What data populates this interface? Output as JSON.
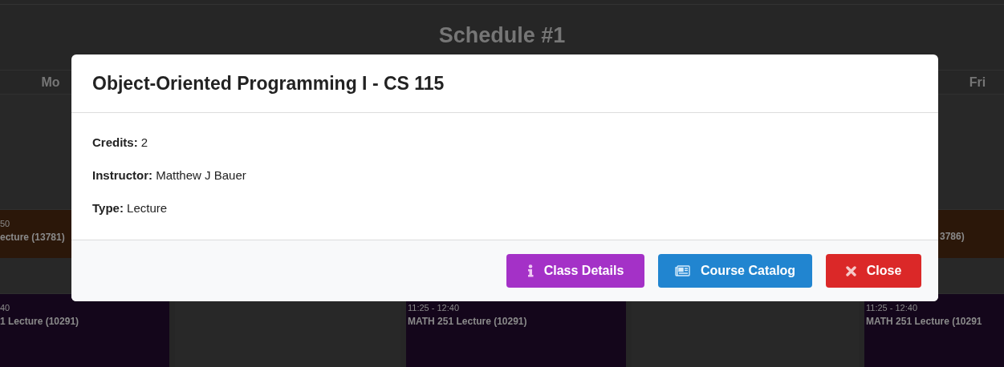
{
  "schedule": {
    "title": "Schedule #1",
    "days": [
      {
        "label": "Mo",
        "slots": [
          {
            "kind": "empty"
          },
          {
            "kind": "event",
            "color": "#2b1709",
            "time": "50",
            "label": "ecture (13781)"
          },
          {
            "kind": "empty"
          },
          {
            "kind": "event",
            "color": "#14061b",
            "time": "40",
            "label": "1 Lecture (10291)"
          }
        ]
      },
      {
        "slots": [
          {
            "kind": "empty"
          },
          {
            "kind": "empty"
          },
          {
            "kind": "empty"
          },
          {
            "kind": "empty"
          }
        ]
      },
      {
        "slots": [
          {
            "kind": "empty"
          },
          {
            "kind": "empty"
          },
          {
            "kind": "empty"
          },
          {
            "kind": "event",
            "color": "#14061b",
            "time": "11:25 - 12:40",
            "label": "MATH 251 Lecture (10291)"
          }
        ]
      },
      {
        "slots": [
          {
            "kind": "empty"
          },
          {
            "kind": "empty"
          },
          {
            "kind": "empty"
          },
          {
            "kind": "empty"
          }
        ]
      },
      {
        "label": "Fri",
        "slots": [
          {
            "kind": "empty"
          },
          {
            "kind": "event",
            "color": "#2b1709",
            "label": "3786)"
          },
          {
            "kind": "empty"
          },
          {
            "kind": "event",
            "color": "#14061b",
            "time": "11:25 - 12:40",
            "label": "MATH 251 Lecture (10291"
          }
        ]
      }
    ]
  },
  "modal": {
    "title": "Object-Oriented Programming I - CS 115",
    "fields": [
      {
        "label": "Credits:",
        "value": "2"
      },
      {
        "label": "Instructor:",
        "value": "Matthew J Bauer"
      },
      {
        "label": "Type:",
        "value": "Lecture"
      }
    ],
    "buttons": [
      {
        "kind": "info",
        "label": "Class Details"
      },
      {
        "kind": "catalog",
        "label": "Course Catalog"
      },
      {
        "kind": "close",
        "label": "Close"
      }
    ]
  }
}
